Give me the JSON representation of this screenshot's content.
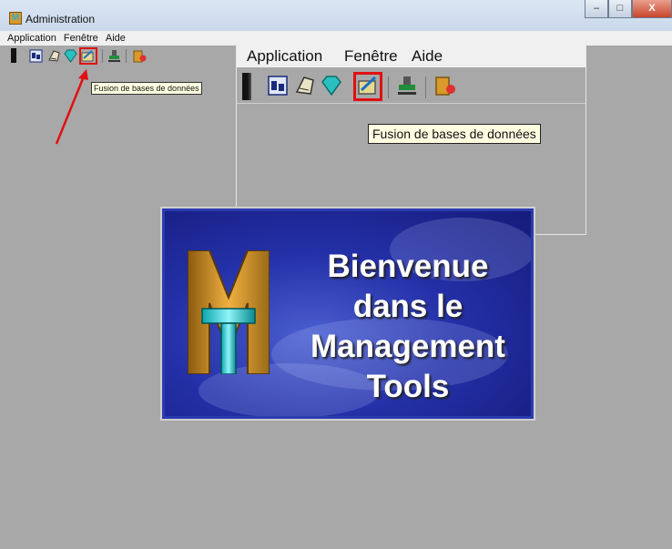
{
  "window": {
    "title": "Administration",
    "controls": [
      "–",
      "□",
      "X"
    ]
  },
  "menu": {
    "items": [
      "Application",
      "Fenêtre",
      "Aide"
    ]
  },
  "toolbar": {
    "icons": [
      "users-icon",
      "database-icon",
      "gem-icon",
      "merge-databases-icon",
      "stamp-icon",
      "logo-exit-icon"
    ],
    "highlighted_tooltip": "Fusion de bases de données"
  },
  "inset": {
    "menu_items": [
      "Application",
      "Fenêtre",
      "Aide"
    ],
    "tooltip": "Fusion de bases de données"
  },
  "splash": {
    "logo_letters": "MT",
    "line1": "Bienvenue",
    "line2": "dans le",
    "line3": "Management",
    "line4": "Tools"
  },
  "colors": {
    "highlight_red": "#e01010",
    "workspace_gray": "#a8a8a8",
    "splash_blue": "#2430a8"
  }
}
